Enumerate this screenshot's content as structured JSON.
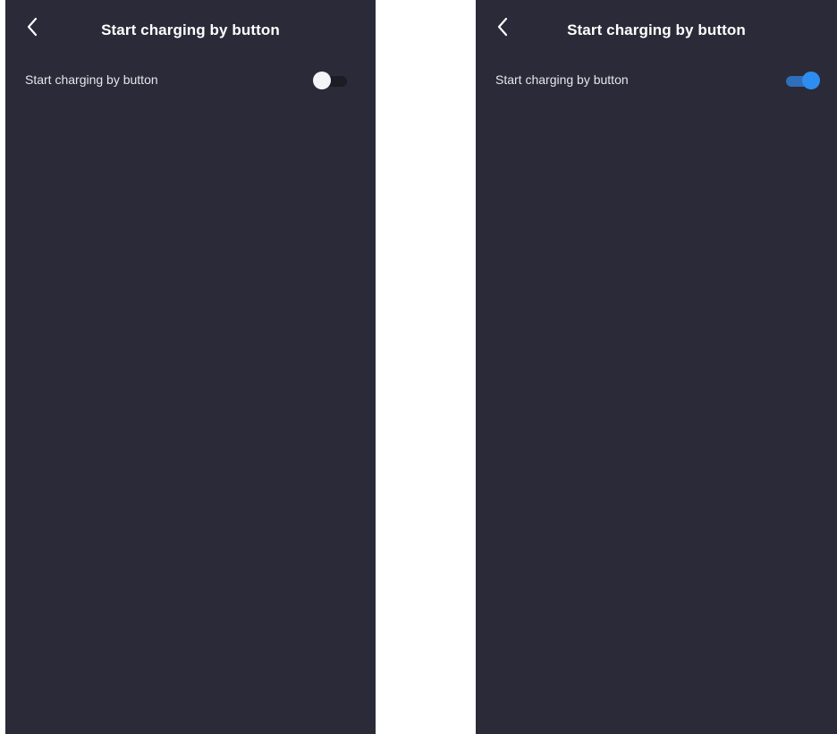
{
  "screens": [
    {
      "header": {
        "back_icon": "chevron-left-icon",
        "title": "Start charging by button"
      },
      "setting": {
        "label": "Start charging by button",
        "toggle_state": "off"
      }
    },
    {
      "header": {
        "back_icon": "chevron-left-icon",
        "title": "Start charging by button"
      },
      "setting": {
        "label": "Start charging by button",
        "toggle_state": "on"
      }
    }
  ],
  "colors": {
    "screen_background": "#2a2a38",
    "toggle_on_knob": "#2e8df0",
    "toggle_on_track": "#2f6fb8",
    "toggle_off_knob": "#f5f5f7",
    "toggle_off_track": "#1c1c25"
  }
}
